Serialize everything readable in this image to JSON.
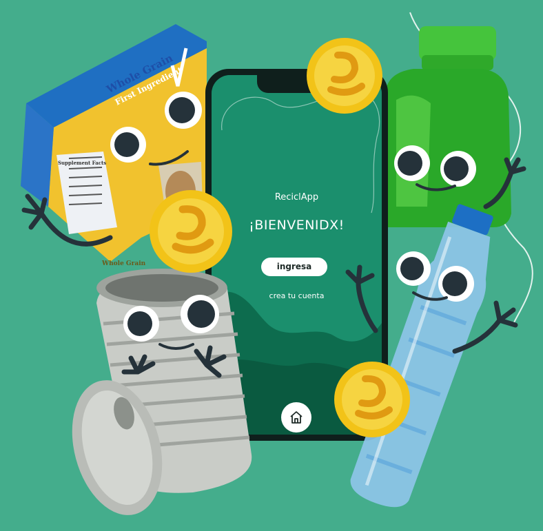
{
  "app": {
    "name": "ReciclApp",
    "welcome_title": "¡BIENVENIDX!",
    "login_button_label": "ingresa",
    "create_account_link": "crea tu cuenta",
    "home_icon": "home-icon"
  },
  "cereal_box": {
    "line1": "Whole Grain",
    "line2": "First Ingredient",
    "side_label": "Supplement Facts",
    "bottom_label": "Whole Grain"
  },
  "colors": {
    "background": "#44ad8c",
    "screen_green": "#1b8f6d",
    "coin_gold": "#f2c318",
    "eye_dark": "#25323a"
  }
}
